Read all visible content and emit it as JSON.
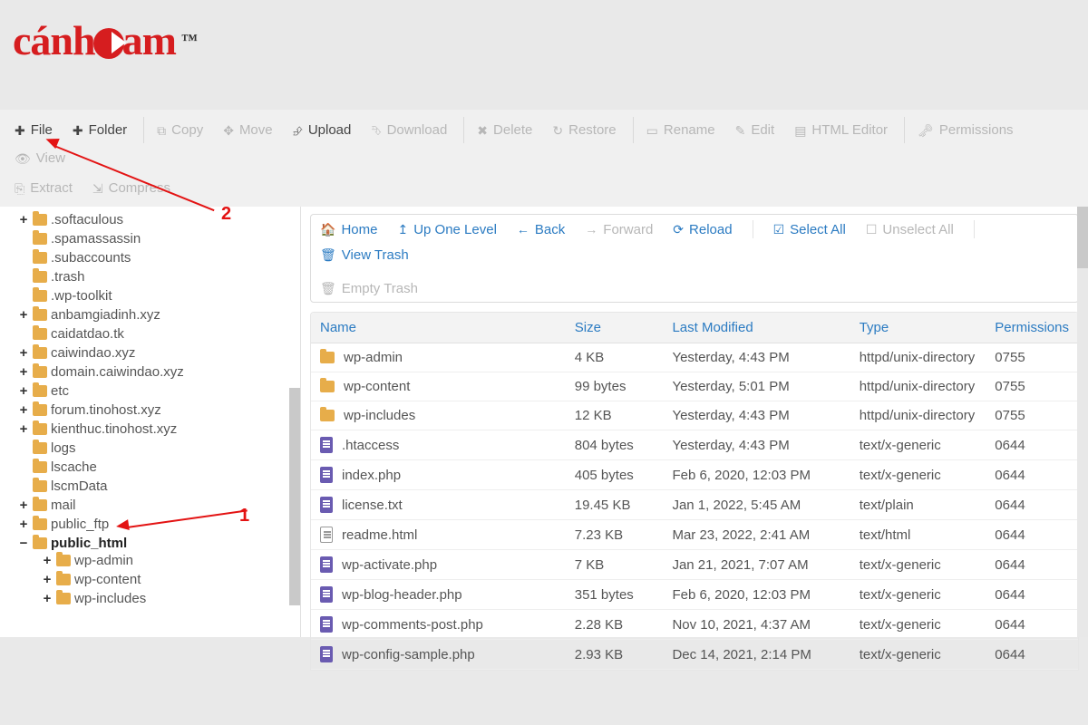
{
  "logo": {
    "text_pre": "c",
    "text_mid": "nh",
    "text_post": "am",
    "tm": "™"
  },
  "toolbar": {
    "file": "File",
    "folder": "Folder",
    "copy": "Copy",
    "move": "Move",
    "upload": "Upload",
    "download": "Download",
    "delete": "Delete",
    "restore": "Restore",
    "rename": "Rename",
    "edit": "Edit",
    "html_editor": "HTML Editor",
    "permissions": "Permissions",
    "view": "View",
    "extract": "Extract",
    "compress": "Compress"
  },
  "nav": {
    "home": "Home",
    "up": "Up One Level",
    "back": "Back",
    "forward": "Forward",
    "reload": "Reload",
    "select_all": "Select All",
    "unselect_all": "Unselect All",
    "view_trash": "View Trash",
    "empty_trash": "Empty Trash"
  },
  "headers": {
    "name": "Name",
    "size": "Size",
    "modified": "Last Modified",
    "type": "Type",
    "perm": "Permissions"
  },
  "tree": {
    "items": [
      {
        "toggle": "+",
        "label": ".softaculous"
      },
      {
        "toggle": "",
        "label": ".spamassassin"
      },
      {
        "toggle": "",
        "label": ".subaccounts"
      },
      {
        "toggle": "",
        "label": ".trash"
      },
      {
        "toggle": "",
        "label": ".wp-toolkit"
      },
      {
        "toggle": "+",
        "label": "anbamgiadinh.xyz"
      },
      {
        "toggle": "",
        "label": "caidatdao.tk"
      },
      {
        "toggle": "+",
        "label": "caiwindao.xyz"
      },
      {
        "toggle": "+",
        "label": "domain.caiwindao.xyz"
      },
      {
        "toggle": "+",
        "label": "etc"
      },
      {
        "toggle": "+",
        "label": "forum.tinohost.xyz"
      },
      {
        "toggle": "+",
        "label": "kienthuc.tinohost.xyz"
      },
      {
        "toggle": "",
        "label": "logs"
      },
      {
        "toggle": "",
        "label": "lscache"
      },
      {
        "toggle": "",
        "label": "lscmData"
      },
      {
        "toggle": "+",
        "label": "mail"
      },
      {
        "toggle": "+",
        "label": "public_ftp"
      },
      {
        "toggle": "−",
        "label": "public_html",
        "bold": true,
        "children": [
          {
            "toggle": "+",
            "label": "wp-admin"
          },
          {
            "toggle": "+",
            "label": "wp-content"
          },
          {
            "toggle": "+",
            "label": "wp-includes"
          }
        ]
      }
    ]
  },
  "rows": [
    {
      "icon": "folder",
      "name": "wp-admin",
      "size": "4 KB",
      "mod": "Yesterday, 4:43 PM",
      "type": "httpd/unix-directory",
      "perm": "0755"
    },
    {
      "icon": "folder",
      "name": "wp-content",
      "size": "99 bytes",
      "mod": "Yesterday, 5:01 PM",
      "type": "httpd/unix-directory",
      "perm": "0755"
    },
    {
      "icon": "folder",
      "name": "wp-includes",
      "size": "12 KB",
      "mod": "Yesterday, 4:43 PM",
      "type": "httpd/unix-directory",
      "perm": "0755"
    },
    {
      "icon": "file",
      "name": ".htaccess",
      "size": "804 bytes",
      "mod": "Yesterday, 4:43 PM",
      "type": "text/x-generic",
      "perm": "0644"
    },
    {
      "icon": "file",
      "name": "index.php",
      "size": "405 bytes",
      "mod": "Feb 6, 2020, 12:03 PM",
      "type": "text/x-generic",
      "perm": "0644"
    },
    {
      "icon": "file",
      "name": "license.txt",
      "size": "19.45 KB",
      "mod": "Jan 1, 2022, 5:45 AM",
      "type": "text/plain",
      "perm": "0644"
    },
    {
      "icon": "html",
      "name": "readme.html",
      "size": "7.23 KB",
      "mod": "Mar 23, 2022, 2:41 AM",
      "type": "text/html",
      "perm": "0644"
    },
    {
      "icon": "file",
      "name": "wp-activate.php",
      "size": "7 KB",
      "mod": "Jan 21, 2021, 7:07 AM",
      "type": "text/x-generic",
      "perm": "0644"
    },
    {
      "icon": "file",
      "name": "wp-blog-header.php",
      "size": "351 bytes",
      "mod": "Feb 6, 2020, 12:03 PM",
      "type": "text/x-generic",
      "perm": "0644"
    },
    {
      "icon": "file",
      "name": "wp-comments-post.php",
      "size": "2.28 KB",
      "mod": "Nov 10, 2021, 4:37 AM",
      "type": "text/x-generic",
      "perm": "0644"
    },
    {
      "icon": "file",
      "name": "wp-config-sample.php",
      "size": "2.93 KB",
      "mod": "Dec 14, 2021, 2:14 PM",
      "type": "text/x-generic",
      "perm": "0644"
    }
  ],
  "annotations": {
    "one": "1",
    "two": "2"
  }
}
